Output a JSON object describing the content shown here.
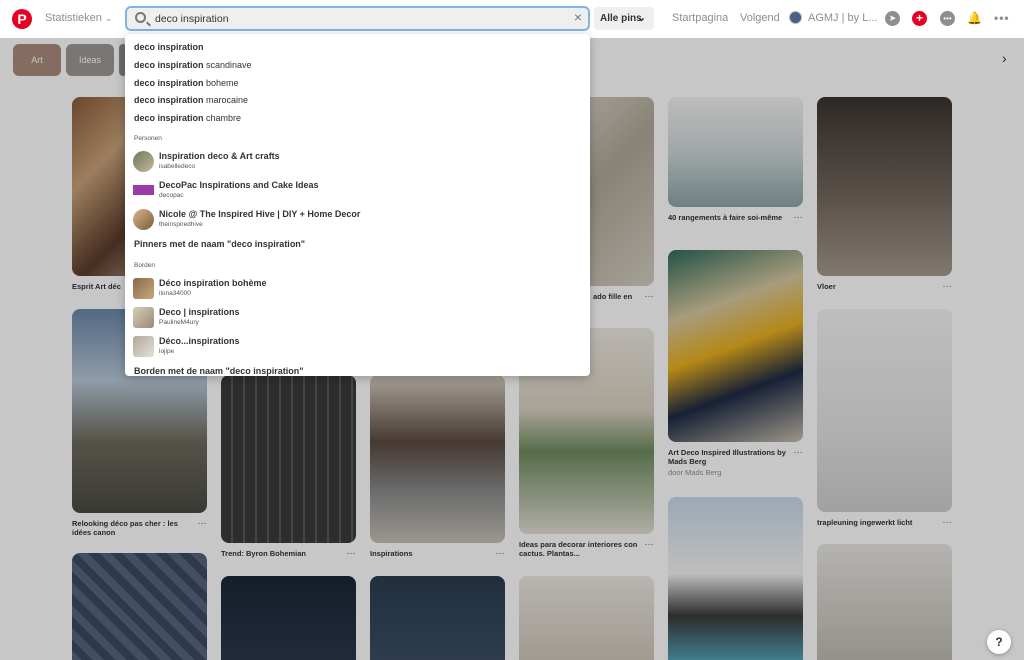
{
  "header": {
    "stats_label": "Statistieken",
    "search_value": "deco inspiration",
    "filter_label": "Alle pins",
    "nav": [
      "Startpagina",
      "Volgend"
    ],
    "profile_name": "AGMJ | by L..."
  },
  "chips": [
    "Art",
    "Ideas"
  ],
  "dropdown": {
    "suggestions": [
      {
        "bold": "deco inspiration",
        "rest": ""
      },
      {
        "bold": "deco inspiration",
        "rest": " scandinave"
      },
      {
        "bold": "deco inspiration",
        "rest": " boheme"
      },
      {
        "bold": "deco inspiration",
        "rest": " marocaine"
      },
      {
        "bold": "deco inspiration",
        "rest": " chambre"
      }
    ],
    "people_title": "Personen",
    "people": [
      {
        "name": "Inspiration deco & Art crafts",
        "handle": "isabelledeco"
      },
      {
        "name": "DecoPac Inspirations and Cake Ideas",
        "handle": "decopac"
      },
      {
        "name": "Nicole @ The Inspired Hive | DIY + Home Decor",
        "handle": "theinspiredhive"
      }
    ],
    "people_link": "Pinners met de naam \"deco inspiration\"",
    "boards_title": "Borden",
    "boards": [
      {
        "name": "Déco inspiration bohème",
        "owner": "ilona34000"
      },
      {
        "name": "Deco | inspirations",
        "owner": "PaulineM4ury"
      },
      {
        "name": "Déco...inspirations",
        "owner": "lojipe"
      }
    ],
    "boards_link": "Borden met de naam \"deco inspiration\""
  },
  "pins": [
    {
      "caption": "Esprit Art déc",
      "sub": ""
    },
    {
      "caption": "Relooking déco pas cher : les idées canon",
      "sub": ""
    },
    {
      "caption": "Trend: Byron Bohemian",
      "sub": ""
    },
    {
      "caption": "Inspirations",
      "sub": ""
    },
    {
      "caption": "ado fille en",
      "sub": ""
    },
    {
      "caption": "Ideas para decorar interiores con cactus. Plantas...",
      "sub": ""
    },
    {
      "caption": "40 rangements à faire soi-même",
      "sub": ""
    },
    {
      "caption": "Art Deco Inspired Illustrations by Mads Berg",
      "sub": "door Mads Berg"
    },
    {
      "caption": "Vloer",
      "sub": ""
    },
    {
      "caption": "trapleuning ingewerkt licht",
      "sub": ""
    }
  ],
  "more_dots": "···",
  "help_label": "?",
  "colors": {
    "brand": "#e60023",
    "focus": "#7fb4e6"
  }
}
